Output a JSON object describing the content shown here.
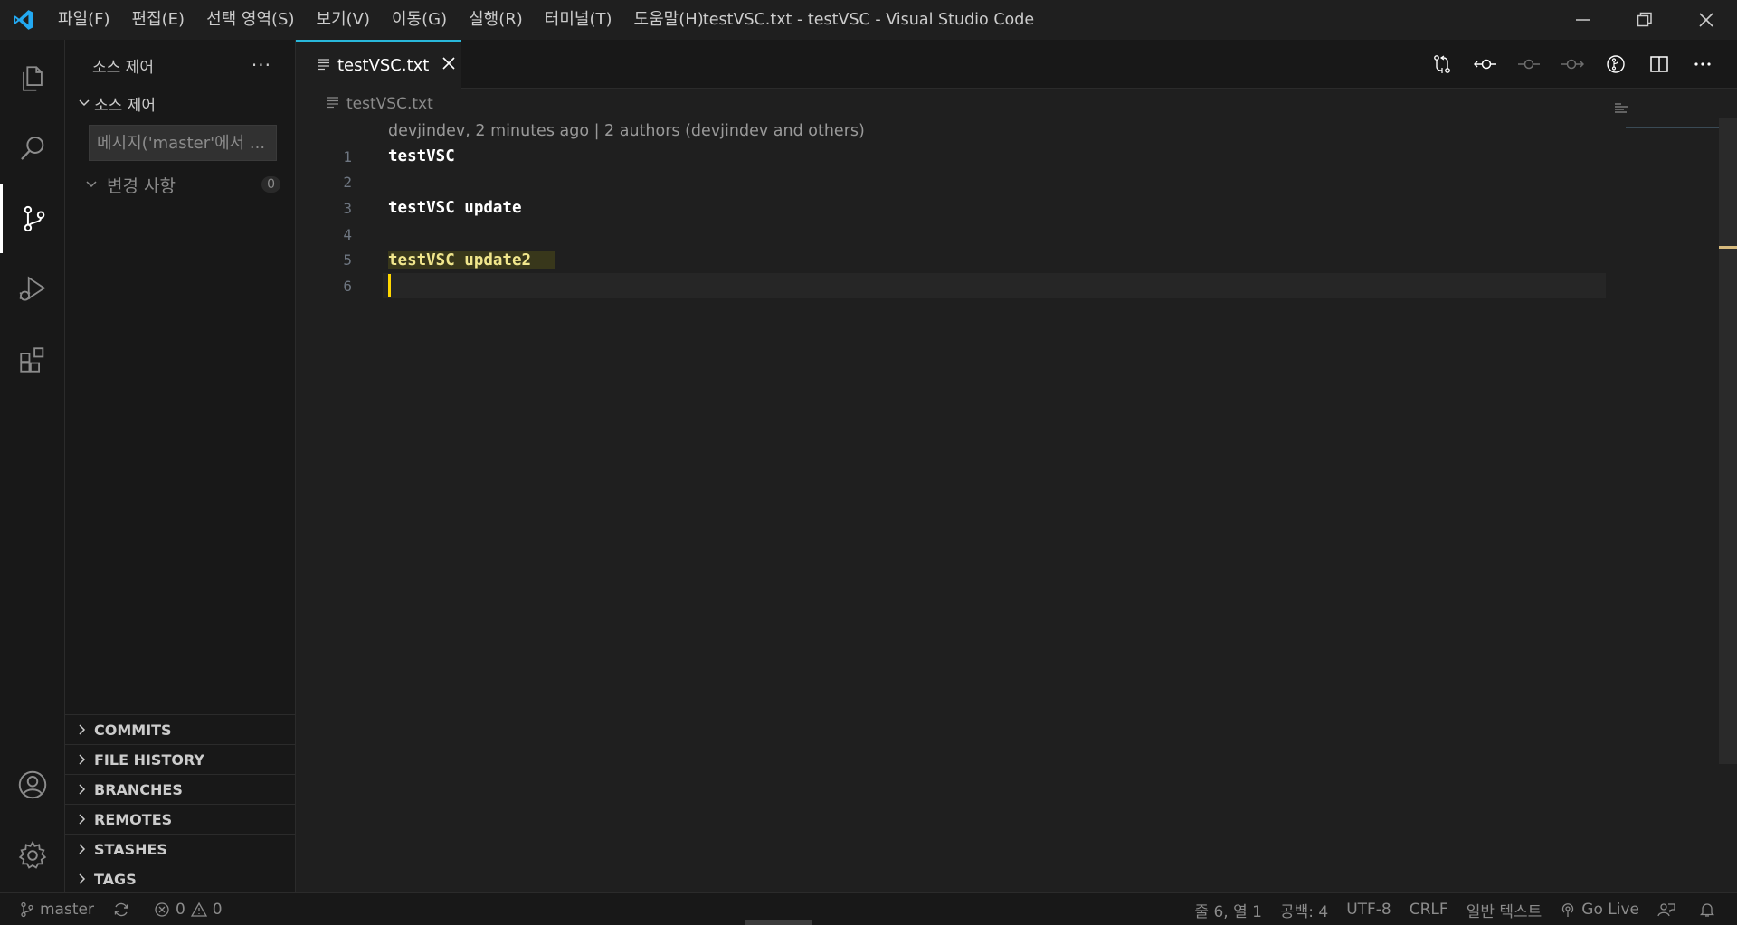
{
  "titlebar": {
    "window_title": "testVSC.txt - testVSC - Visual Studio Code",
    "menu": [
      "파일(F)",
      "편집(E)",
      "선택 영역(S)",
      "보기(V)",
      "이동(G)",
      "실행(R)",
      "터미널(T)",
      "도움말(H)"
    ]
  },
  "activitybar": {
    "items": [
      "explorer-icon",
      "search-icon",
      "source-control-icon",
      "run-debug-icon",
      "extensions-icon"
    ],
    "bottom": [
      "account-icon",
      "gear-icon"
    ],
    "active": "source-control-icon"
  },
  "sidebar": {
    "title": "소스 제어",
    "more": "···",
    "section": "소스 제어",
    "message_placeholder": "메시지('master'에서 ...",
    "changes_label": "변경 사항",
    "changes_count": "0",
    "panes": [
      "COMMITS",
      "FILE HISTORY",
      "BRANCHES",
      "REMOTES",
      "STASHES",
      "TAGS"
    ]
  },
  "editor": {
    "tab_label": "testVSC.txt",
    "breadcrumb": "testVSC.txt",
    "blame": "devjindev, 2 minutes ago | 2 authors (devjindev and others)",
    "lines": [
      {
        "num": "1",
        "text": "testVSC"
      },
      {
        "num": "2",
        "text": ""
      },
      {
        "num": "3",
        "text": "testVSC update"
      },
      {
        "num": "4",
        "text": ""
      },
      {
        "num": "5",
        "text": "testVSC update2"
      },
      {
        "num": "6",
        "text": ""
      }
    ]
  },
  "statusbar": {
    "branch": "master",
    "errors": "0",
    "warnings": "0",
    "position": "줄 6, 열 1",
    "spaces": "공백: 4",
    "encoding": "UTF-8",
    "eol": "CRLF",
    "language": "일반 텍스트",
    "golive": "Go Live"
  },
  "colors": {
    "accent": "#29b8db",
    "highlight_text": "#f0e68c",
    "caret": "#ffd700",
    "logo": "#23a9f2"
  }
}
